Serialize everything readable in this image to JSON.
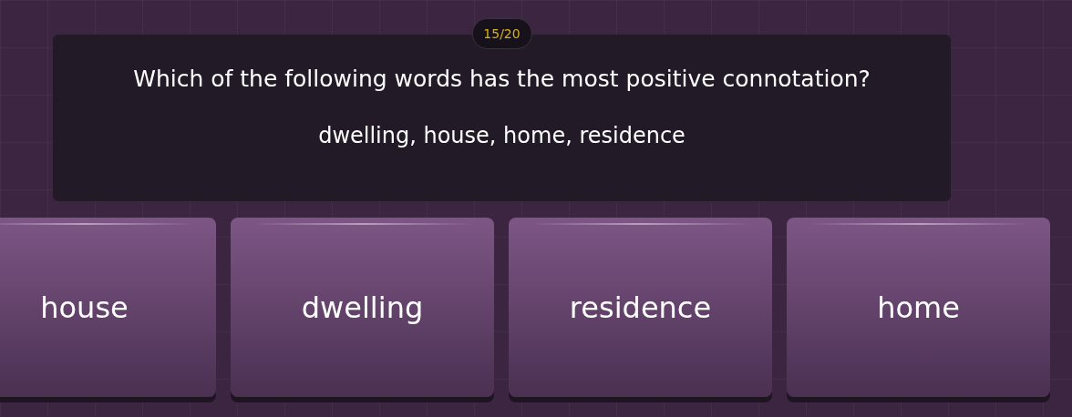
{
  "progress": "15/20",
  "question": {
    "prompt": "Which of the following words has the most positive connotation?",
    "words": "dwelling, house, home, residence"
  },
  "answers": [
    {
      "label": "house"
    },
    {
      "label": "dwelling"
    },
    {
      "label": "residence"
    },
    {
      "label": "home"
    }
  ]
}
